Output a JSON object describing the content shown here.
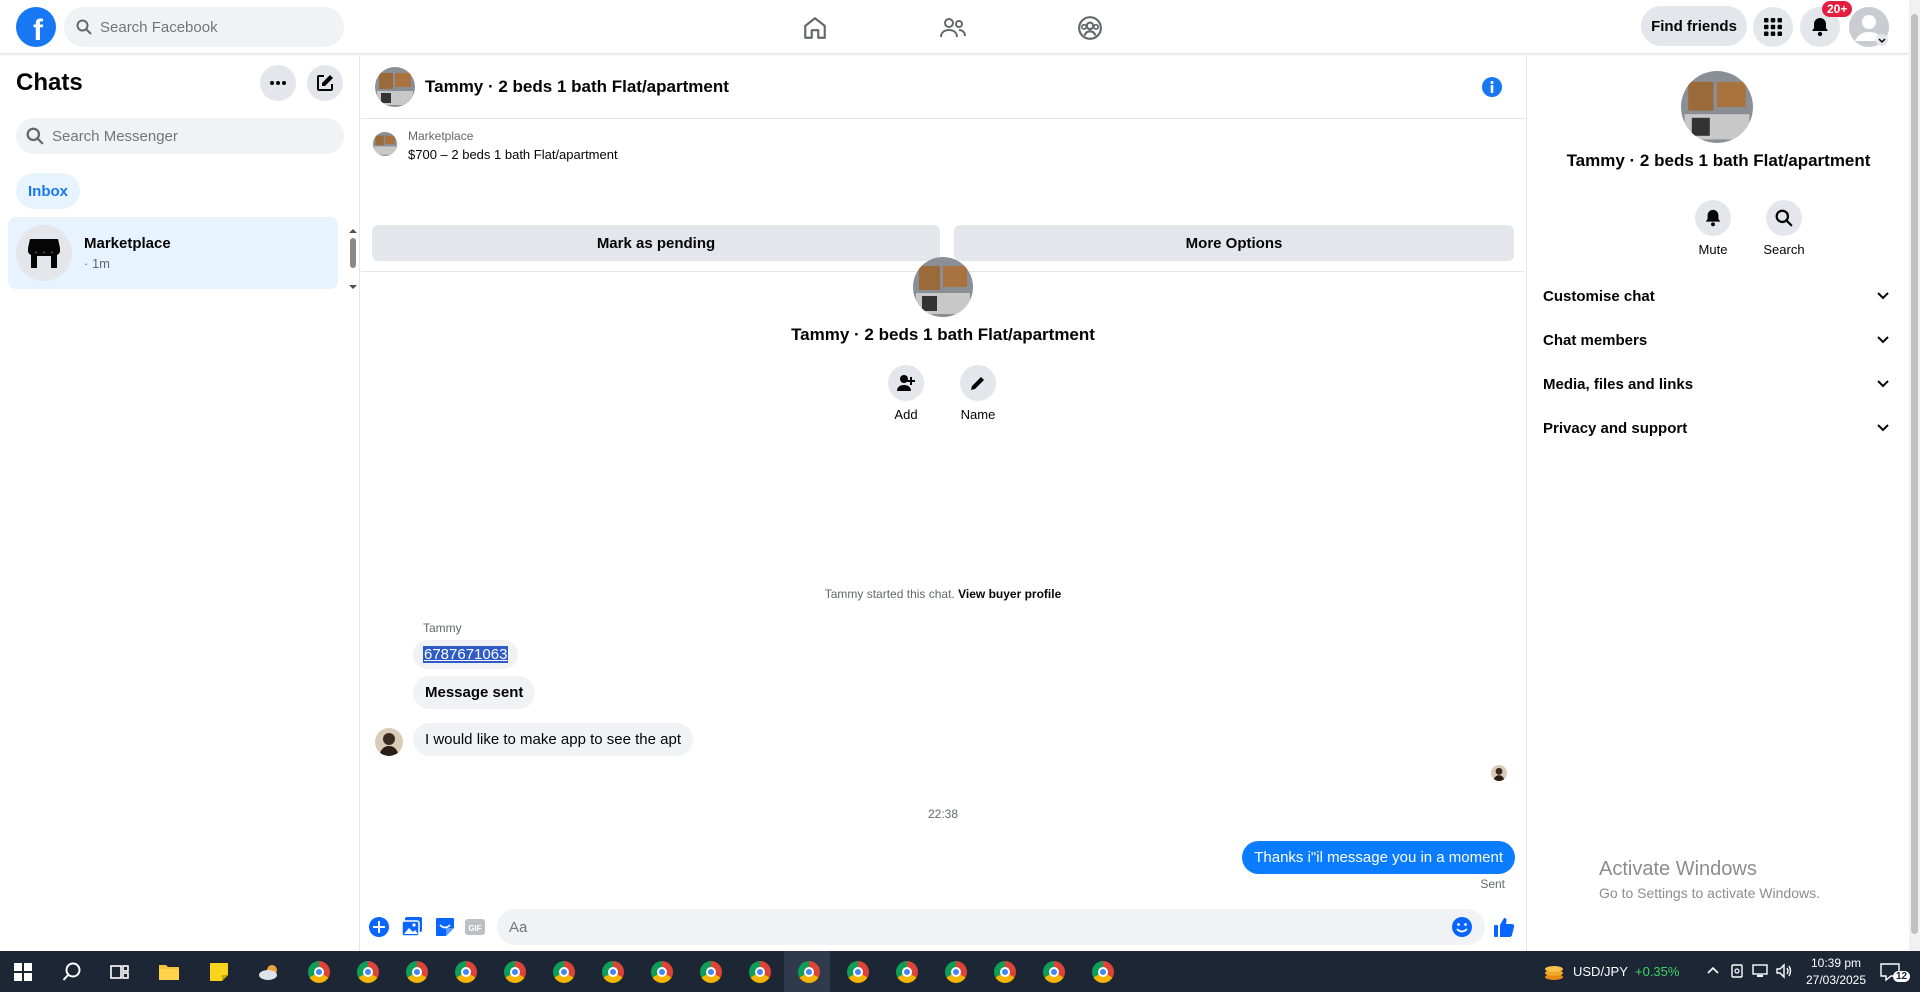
{
  "topnav": {
    "search_placeholder": "Search Facebook",
    "find_friends": "Find friends",
    "notif_badge": "20+",
    "logo_letter": "f"
  },
  "left": {
    "title": "Chats",
    "search_placeholder": "Search Messenger",
    "inbox": "Inbox",
    "chats": [
      {
        "name": "Marketplace",
        "time": "· 1m"
      }
    ]
  },
  "conversation": {
    "title": "Tammy · 2 beds 1 bath Flat/apartment",
    "marketplace_label": "Marketplace",
    "listing": "$700 – 2 beds 1 bath Flat/apartment",
    "mark_pending": "Mark as pending",
    "more_options": "More Options",
    "intro_name": "Tammy · 2 beds 1 bath Flat/apartment",
    "add_label": "Add",
    "name_label": "Name",
    "started_text": "Tammy started this chat.",
    "view_buyer": "View buyer profile",
    "sender": "Tammy",
    "incoming": [
      "6787671063",
      "Message sent",
      "I would like to make app to see the apt"
    ],
    "timestamp": "22:38",
    "outgoing": "Thanks i\"il message you in a moment",
    "sent_status": "Sent",
    "composer_placeholder": "Aa"
  },
  "right": {
    "name": "Tammy · 2 beds 1 bath Flat/apartment",
    "mute": "Mute",
    "search": "Search",
    "sections": [
      "Customise chat",
      "Chat members",
      "Media, files and links",
      "Privacy and support"
    ],
    "activate_title": "Activate Windows",
    "activate_sub": "Go to Settings to activate Windows."
  },
  "taskbar": {
    "ticker": "USD/JPY",
    "ticker_change": "+0.35%",
    "time": "10:39 pm",
    "date": "27/03/2025",
    "notif_count": "12"
  },
  "colors": {
    "brand": "#1877f2",
    "outgoing_bubble": "#0a7cff",
    "incoming_bubble": "#f0f2f5",
    "badge": "#e41e3f",
    "ticker_up": "#3fd16a"
  }
}
